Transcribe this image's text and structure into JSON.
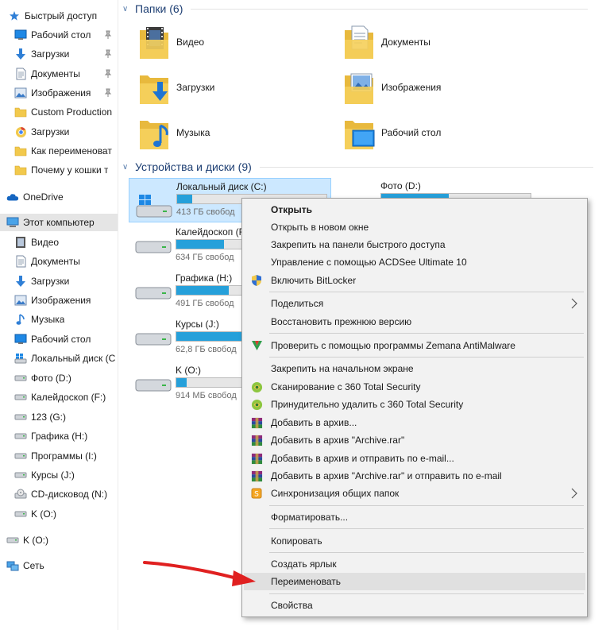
{
  "sidebar": {
    "quick_access": {
      "label": "Быстрый доступ",
      "icon": "star-icon"
    },
    "pinned": [
      {
        "label": "Рабочий стол",
        "icon": "desktop-icon",
        "pinned": true
      },
      {
        "label": "Загрузки",
        "icon": "download-icon",
        "pinned": true
      },
      {
        "label": "Документы",
        "icon": "documents-icon",
        "pinned": true
      },
      {
        "label": "Изображения",
        "icon": "pictures-icon",
        "pinned": true
      },
      {
        "label": "Custom Production",
        "icon": "folder-icon"
      },
      {
        "label": "Загрузки",
        "icon": "chrome-icon"
      },
      {
        "label": "Как переименоват",
        "icon": "folder-icon"
      },
      {
        "label": "Почему у кошки т",
        "icon": "folder-icon"
      }
    ],
    "onedrive": {
      "label": "OneDrive",
      "icon": "cloud-icon"
    },
    "this_pc": {
      "label": "Этот компьютер",
      "icon": "computer-icon"
    },
    "pc_items": [
      {
        "label": "Видео",
        "icon": "video-icon"
      },
      {
        "label": "Документы",
        "icon": "documents-icon"
      },
      {
        "label": "Загрузки",
        "icon": "download-icon"
      },
      {
        "label": "Изображения",
        "icon": "pictures-icon"
      },
      {
        "label": "Музыка",
        "icon": "music-icon"
      },
      {
        "label": "Рабочий стол",
        "icon": "desktop-icon"
      },
      {
        "label": "Локальный диск (C",
        "icon": "windows-drive-icon"
      },
      {
        "label": "Фото  (D:)",
        "icon": "drive-icon"
      },
      {
        "label": "Калейдоскоп (F:)",
        "icon": "drive-icon"
      },
      {
        "label": "123 (G:)",
        "icon": "drive-icon"
      },
      {
        "label": "Графика (H:)",
        "icon": "drive-icon"
      },
      {
        "label": "Программы (I:)",
        "icon": "drive-icon"
      },
      {
        "label": "Курсы (J:)",
        "icon": "drive-icon"
      },
      {
        "label": "CD-дисковод (N:)",
        "icon": "cd-icon"
      },
      {
        "label": "K (O:)",
        "icon": "drive-icon"
      }
    ],
    "k_drive": {
      "label": "K (O:)",
      "icon": "drive-icon"
    },
    "network": {
      "label": "Сеть",
      "icon": "network-icon"
    }
  },
  "folders_group": {
    "title": "Папки (6)"
  },
  "folders": [
    {
      "name": "Видео",
      "icon": "video-folder-icon"
    },
    {
      "name": "Документы",
      "icon": "documents-folder-icon"
    },
    {
      "name": "Загрузки",
      "icon": "downloads-folder-icon"
    },
    {
      "name": "Изображения",
      "icon": "pictures-folder-icon"
    },
    {
      "name": "Музыка",
      "icon": "music-folder-icon"
    },
    {
      "name": "Рабочий стол",
      "icon": "desktop-folder-icon"
    }
  ],
  "drives_group": {
    "title": "Устройства и диски (9)"
  },
  "drives": [
    {
      "name": "Локальный диск (C:)",
      "free": "413 ГБ свобод",
      "used_fraction": 0.1,
      "selected": true
    },
    {
      "name": "Калейдоскоп (F:)",
      "free": "634 ГБ свобод",
      "used_fraction": 0.32
    },
    {
      "name": "Графика (H:)",
      "free": "491 ГБ свобод",
      "used_fraction": 0.35
    },
    {
      "name": "Курсы (J:)",
      "free": "62,8 ГБ свобод",
      "used_fraction": 0.55
    },
    {
      "name": "K (O:)",
      "free": "914 МБ свобод",
      "used_fraction": 0.07
    },
    {
      "name": "Фото  (D:)",
      "free": "",
      "used_fraction": 0.45
    }
  ],
  "context_menu": {
    "items": [
      {
        "label": "Открыть",
        "bold": true
      },
      {
        "label": "Открыть в новом окне"
      },
      {
        "label": "Закрепить на панели быстрого доступа"
      },
      {
        "label": "Управление с помощью ACDSee Ultimate 10"
      },
      {
        "label": "Включить BitLocker",
        "icon": "shield-uac-icon"
      },
      {
        "label": "Поделиться",
        "submenu": true
      },
      {
        "label": "Восстановить прежнюю версию"
      },
      {
        "label": "Проверить с помощью программы Zemana AntiMalware",
        "icon": "zemana-icon"
      },
      {
        "label": "Закрепить на начальном экране"
      },
      {
        "label": "Сканирование с 360 Total Security",
        "icon": "total-security-icon"
      },
      {
        "label": "Принудительно удалить с  360 Total Security",
        "icon": "total-security-icon"
      },
      {
        "label": "Добавить в архив...",
        "icon": "winrar-icon"
      },
      {
        "label": "Добавить в архив \"Archive.rar\"",
        "icon": "winrar-icon"
      },
      {
        "label": "Добавить в архив и отправить по e-mail...",
        "icon": "winrar-icon"
      },
      {
        "label": "Добавить в архив \"Archive.rar\" и отправить по e-mail",
        "icon": "winrar-icon"
      },
      {
        "label": "Синхронизация общих папок",
        "icon": "sync-folders-icon",
        "submenu": true
      },
      {
        "label": "Форматировать..."
      },
      {
        "label": "Копировать"
      },
      {
        "label": "Создать ярлык"
      },
      {
        "label": "Переименовать",
        "highlighted": true
      },
      {
        "label": "Свойства"
      }
    ]
  },
  "colors": {
    "accent": "#26a0da",
    "selection": "#cce8ff",
    "annotation_arrow": "#e02020",
    "folder": "#f2c94c"
  }
}
